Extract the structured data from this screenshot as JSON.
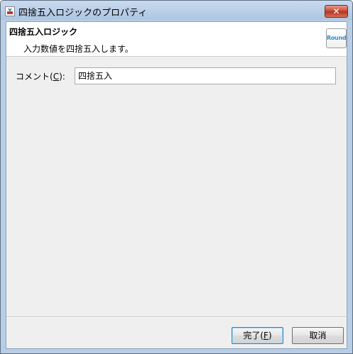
{
  "window": {
    "title": "四捨五入ロジックのプロパティ",
    "close_label": "✕"
  },
  "banner": {
    "title": "四捨五入ロジック",
    "description": "入力数値を四捨五入します。",
    "icon_label": "Round"
  },
  "form": {
    "comment_label_prefix": "コメント(",
    "comment_mnemonic": "C",
    "comment_label_suffix": "):",
    "comment_value": "四捨五入"
  },
  "buttons": {
    "ok_prefix": "完了(",
    "ok_mnemonic": "F",
    "ok_suffix": ")",
    "cancel_label": "取消"
  }
}
